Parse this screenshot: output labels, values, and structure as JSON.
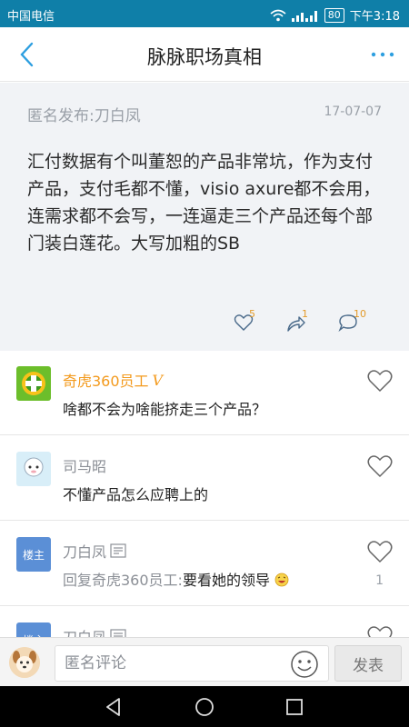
{
  "status_bar": {
    "carrier": "中国电信",
    "battery": "80",
    "time": "下午3:18"
  },
  "nav": {
    "title": "脉脉职场真相"
  },
  "post": {
    "author": "匿名发布:刀白凤",
    "date": "17-07-07",
    "body": "汇付数据有个叫董恕的产品非常坑，作为支付产品，支付毛都不懂，visio axure都不会用，连需求都不会写，一连逼走三个产品还每个部门装白莲花。大写加粗的SB",
    "likes": "5",
    "shares": "1",
    "comments": "10"
  },
  "comments": [
    {
      "name": "奇虎360员工",
      "badge": "V",
      "text": "啥都不会为啥能挤走三个产品？",
      "avatar": "qihoo-logo"
    },
    {
      "name": "司马昭",
      "text": "不懂产品怎么应聘上的",
      "avatar": "sheep-avatar"
    },
    {
      "name": "刀白凤",
      "owner_tag": "楼主",
      "reply_prefix": "回复奇虎360员工:",
      "text": "要看她的领导",
      "likes": "1"
    },
    {
      "name": "刀白凤",
      "owner_tag": "楼主"
    }
  ],
  "input": {
    "placeholder": "匿名评论",
    "send_label": "发表"
  },
  "colors": {
    "status_bar": "#0f7fa8",
    "accent": "#2e9fe0",
    "vip_name": "#f39a1d",
    "count": "#e39b2a",
    "owner_tag": "#5b8fd6"
  }
}
